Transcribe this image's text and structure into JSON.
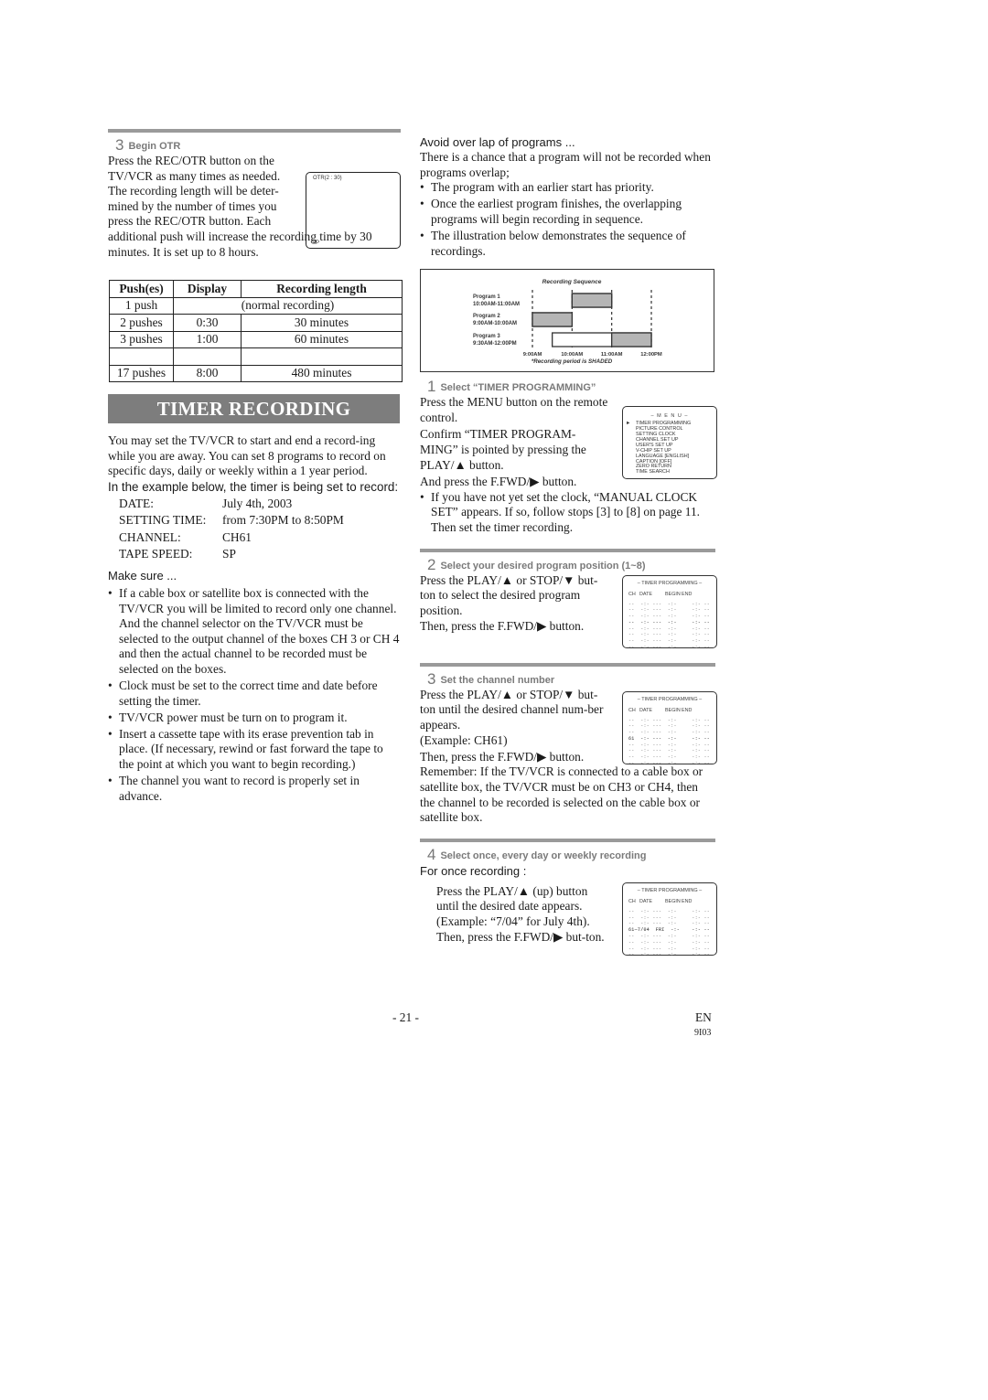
{
  "left": {
    "otr": {
      "step_num": "3",
      "step_title": "Begin OTR",
      "screen_top": "OTR(2 : 30)",
      "screen_bottom": "SP",
      "text": "Press the REC/OTR button on the TV/VCR as many times as needed. The recording length will be determined by the number of times you press the REC/OTR button. Each additional push will increase the recording time by 30 minutes. It is set up to 8 hours.",
      "text_a": "Press the REC/OTR button on the TV/VCR as many times as needed. The recording length will be deter-mined by the number of times you press the REC/OTR button. Each",
      "text_b": "additional push will increase the recording time by 30 minutes. It is set up to 8 hours."
    },
    "table": {
      "headers": [
        "Push(es)",
        "Display",
        "Recording length"
      ],
      "rows": [
        {
          "push": "1 push",
          "merged": "(normal recording)"
        },
        {
          "push": "2 pushes",
          "display": "0:30",
          "length": "30 minutes"
        },
        {
          "push": "3 pushes",
          "display": "1:00",
          "length": "60 minutes"
        },
        {
          "push": "",
          "display": "",
          "length": ""
        },
        {
          "push": "17 pushes",
          "display": "8:00",
          "length": "480 minutes"
        }
      ]
    },
    "banner": "TIMER RECORDING",
    "intro": "You may set the TV/VCR to start and end a record-ing while you are away. You can set 8 programs to record on specific days, daily or weekly within a 1 year period.",
    "example_lead": "In the example below, the timer is being set to record:",
    "example": [
      {
        "key": "DATE:",
        "value": "July 4th, 2003"
      },
      {
        "key": "SETTING TIME:",
        "value": "from 7:30PM to 8:50PM"
      },
      {
        "key": "CHANNEL:",
        "value": "CH61"
      },
      {
        "key": "TAPE SPEED:",
        "value": "SP"
      }
    ],
    "make_sure_heading": "Make sure ...",
    "make_sure": [
      "If a cable box or satellite box is connected with the TV/VCR you will be limited to record only one channel.  And the channel selector on the TV/VCR must be selected to the output channel of the boxes CH 3 or CH 4 and then the actual channel to be recorded must be selected on the boxes.",
      "Clock must be set to the correct time and date before setting the timer.",
      "TV/VCR power must be turn on to program it.",
      "Insert a cassette tape with its erase prevention tab in place. (If necessary, rewind or fast forward the tape to the point at which you want to begin recording.)",
      "The channel you want to record is properly set in advance."
    ]
  },
  "right": {
    "overlap_heading": "Avoid over lap of programs ...",
    "overlap_text": "There is a chance that a program will not be recorded when programs overlap;",
    "overlap_bullets": [
      "The program with an earlier start has priority.",
      "Once the earliest program finishes, the overlapping programs will begin recording in sequence.",
      "The illustration below demonstrates the sequence of recordings."
    ],
    "sequence": {
      "title": "Recording Sequence",
      "note": "*Recording period is SHADED",
      "axis_ticks": [
        "9:00AM",
        "10:00AM",
        "11:00AM",
        "12:00PM"
      ],
      "programs": [
        {
          "name": "Program 1",
          "time": "10:00AM-11:00AM",
          "start": 10.0,
          "end": 11.0,
          "rec_start": 10.0,
          "rec_end": 11.0
        },
        {
          "name": "Program 2",
          "time": "9:00AM-10:00AM",
          "start": 9.0,
          "end": 10.0,
          "rec_start": 9.0,
          "rec_end": 10.0
        },
        {
          "name": "Program 3",
          "time": "9:30AM-12:00PM",
          "start": 9.5,
          "end": 12.0,
          "rec_start": 11.0,
          "rec_end": 12.0
        }
      ]
    },
    "step1": {
      "num": "1",
      "title": "Select “TIMER PROGRAMMING”",
      "lines": [
        "Press the MENU button on the remote control.",
        "Confirm “TIMER PROGRAM-MING” is pointed by pressing the PLAY/▲ button.",
        "And press the F.FWD/▶ button."
      ],
      "note": "If you have not yet set the clock, “MANUAL CLOCK SET” appears. If so, follow stops [3] to [8] on page 11. Then set the timer recording.",
      "menu": {
        "title": "– M E N U –",
        "items": [
          "TIMER PROGRAMMING",
          "PICTURE CONTROL",
          "SETTING CLOCK",
          "CHANNEL SET UP",
          "USER'S SET UP",
          "V-CHIP SET UP",
          "LANGUAGE  [ENGLISH]",
          "CAPTION  [OFF]",
          "ZERO RETURN",
          "TIME SEARCH"
        ],
        "selected": "TIMER PROGRAMMING"
      }
    },
    "step2": {
      "num": "2",
      "title": "Select your desired program position (1~8)",
      "lines": [
        "Press the PLAY/▲ or STOP/▼ but-ton to select the desired program position.",
        "Then, press the F.FWD/▶ button."
      ]
    },
    "step3": {
      "num": "3",
      "title": "Set the channel number",
      "lines": [
        "Press the PLAY/▲ or STOP/▼ but-ton until the desired channel num-ber appears.",
        "(Example: CH61)",
        "Then, press the F.FWD/▶ button."
      ],
      "remember": "Remember: If the TV/VCR is connected to a cable box or satellite box, the TV/VCR must be on CH3 or CH4, then the channel to be recorded is selected on the cable box or satellite box."
    },
    "step4": {
      "num": "4",
      "title": "Select once, every day or weekly recording",
      "subhead": "For once recording :",
      "text": "Press the PLAY/▲ (up) button until the desired date appears. (Example: “7/04” for July 4th). Then, press the F.FWD/▶ but-ton."
    },
    "timer_osd": {
      "title": "– TIMER PROGRAMMING –",
      "headers": [
        "CH",
        "DATE",
        "BEGIN",
        "END"
      ],
      "empty_row": "--  -:- ---  -:-     -:- --",
      "ch_row": "61  -:- ---  -:-     -:- --",
      "date_row": "61—7/04  FRI  -:-    -:- --"
    }
  },
  "footer": {
    "page": "- 21 -",
    "lang": "EN",
    "code": "9I03"
  }
}
